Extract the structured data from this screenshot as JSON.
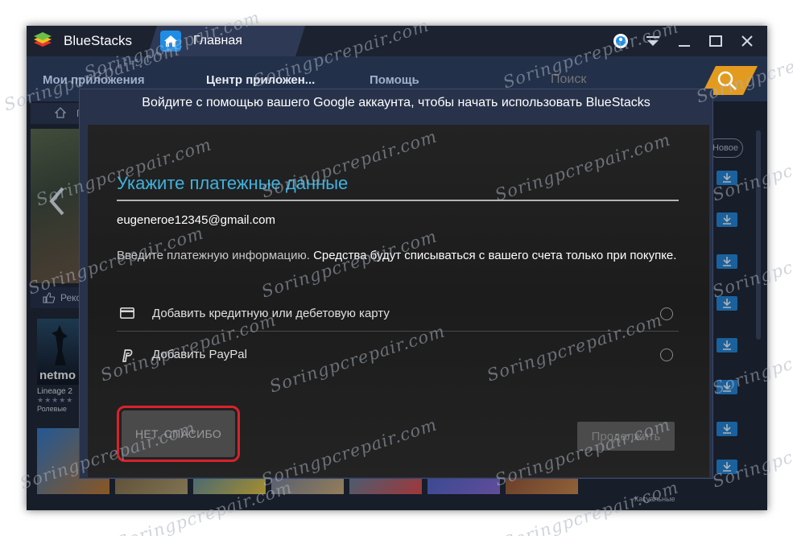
{
  "window": {
    "app_name": "BlueStacks",
    "home_tab_label": "Главная"
  },
  "nav": {
    "items": [
      "Мои приложения",
      "Центр приложен...",
      "Помощь"
    ],
    "search_placeholder": "Поиск"
  },
  "background": {
    "breadcrumb": "П",
    "recommended": "Реко",
    "new_label": "Новое",
    "app": {
      "name": "Lineage 2",
      "brand": "netmo",
      "stars": "★★★★★",
      "category": "Ролевые"
    },
    "bottom_right_label": "Касуальные"
  },
  "modal": {
    "header": "Войдите с помощью вашего Google аккаунта, чтобы начать использовать BlueStacks",
    "title": "Укажите платежные данные",
    "email": "eugeneroe12345@gmail.com",
    "desc_part1": "Введите платежную информацию. ",
    "desc_part2": "Средства будут списываться с вашего счета только при покупке.",
    "option_card": "Добавить кредитную или дебетовую карту",
    "option_paypal": "Добавить PayPal",
    "no_thanks": "НЕТ, СПАСИБО",
    "continue": "Продолжить"
  },
  "watermark": "Soringpcrepair.com",
  "colors": {
    "accent_blue": "#3fb3e0",
    "search_orange": "#e39b1f",
    "highlight_red": "#d8222b",
    "download_blue": "#2288dd"
  },
  "icons": [
    "bluestacks-logo-icon",
    "home-icon",
    "user-icon",
    "dropdown-icon",
    "minimize-icon",
    "maximize-icon",
    "close-icon",
    "search-icon",
    "credit-card-icon",
    "paypal-icon",
    "download-icon",
    "thumbs-up-icon",
    "chevron-left-icon"
  ]
}
